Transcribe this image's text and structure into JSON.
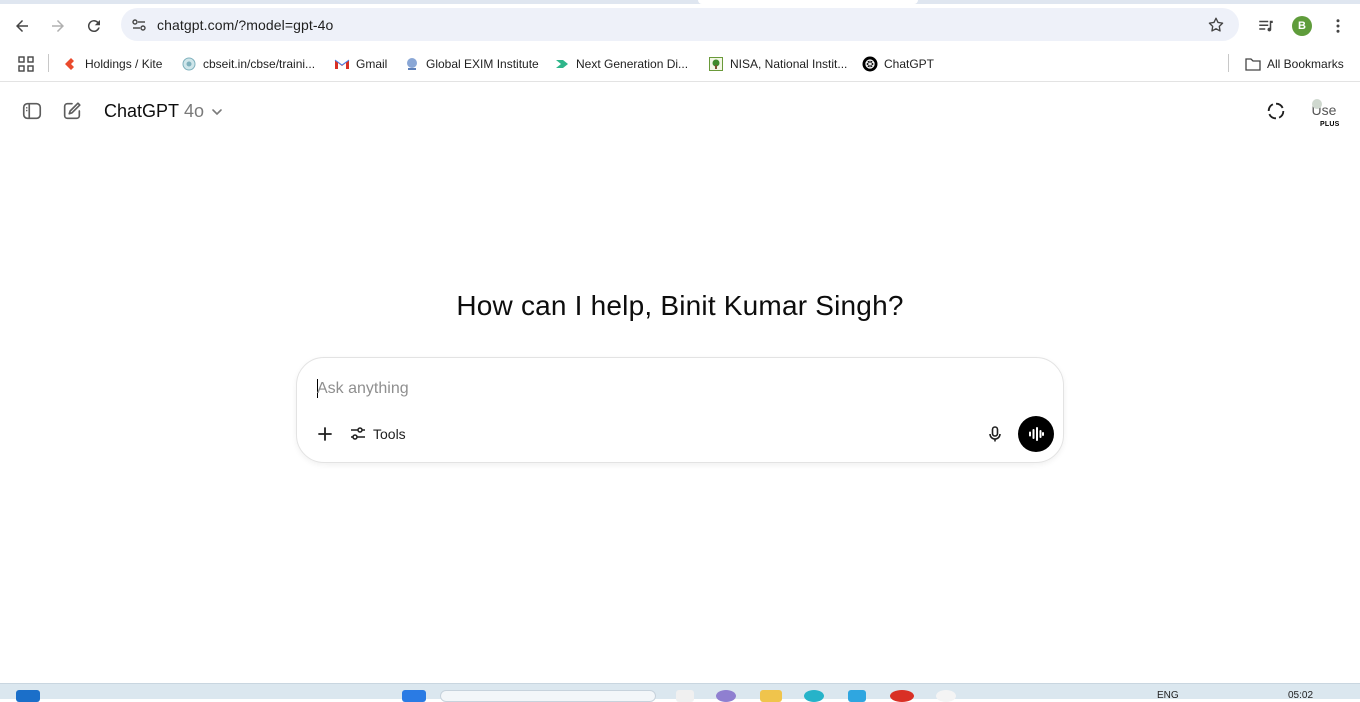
{
  "browser": {
    "url": "chatgpt.com/?model=gpt-4o",
    "profile_initial": "B",
    "bookmarks": [
      {
        "label": "Holdings / Kite",
        "icon": "kite-icon"
      },
      {
        "label": "cbseit.in/cbse/traini...",
        "icon": "cbse-icon"
      },
      {
        "label": "Gmail",
        "icon": "gmail-icon"
      },
      {
        "label": "Global EXIM Institute",
        "icon": "globe-icon"
      },
      {
        "label": "Next Generation Di...",
        "icon": "arrow-icon"
      },
      {
        "label": "NISA, National Instit...",
        "icon": "tree-icon"
      },
      {
        "label": "ChatGPT",
        "icon": "openai-icon"
      }
    ],
    "all_bookmarks_label": "All Bookmarks"
  },
  "app": {
    "model_name": "ChatGPT",
    "model_version": "4o",
    "avatar_alt": "Use",
    "plan_badge": "PLUS",
    "greeting": "How can I help, Binit Kumar Singh?",
    "composer": {
      "placeholder": "Ask anything",
      "tools_label": "Tools"
    }
  },
  "taskbar": {
    "lang": "ENG",
    "time": "05:02"
  }
}
